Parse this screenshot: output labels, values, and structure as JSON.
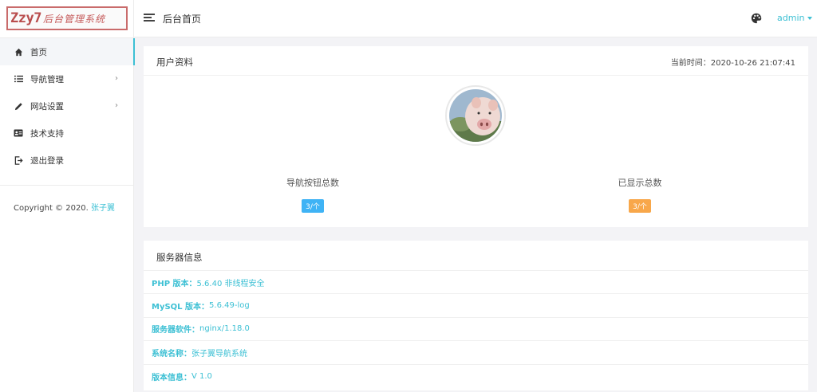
{
  "logo": {
    "main": "Zzy7",
    "sub": "后台管理系统"
  },
  "header": {
    "title": "后台首页",
    "user": "admin",
    "theme_icon": "palette-icon",
    "menu_icon": "menu-toggle-icon"
  },
  "sidebar": {
    "items": [
      {
        "label": "首页",
        "icon": "home-icon",
        "active": true,
        "has_children": false
      },
      {
        "label": "导航管理",
        "icon": "list-icon",
        "active": false,
        "has_children": true
      },
      {
        "label": "网站设置",
        "icon": "pencil-icon",
        "active": false,
        "has_children": true
      },
      {
        "label": "技术支持",
        "icon": "id-card-icon",
        "active": false,
        "has_children": false
      },
      {
        "label": "退出登录",
        "icon": "logout-icon",
        "active": false,
        "has_children": false
      }
    ],
    "copyright_prefix": "Copyright © 2020.",
    "copyright_author": "张子翼"
  },
  "profile": {
    "title": "用户资料",
    "time_label": "当前时间：",
    "time_value": "2020-10-26 21:07:41",
    "stats": [
      {
        "label": "导航按钮总数",
        "value": "3/个",
        "color": "#3fb3f5"
      },
      {
        "label": "已显示总数",
        "value": "3/个",
        "color": "#f8a74a"
      }
    ]
  },
  "server": {
    "title": "服务器信息",
    "rows": [
      {
        "label": "PHP 版本：",
        "value": "5.6.40 非线程安全"
      },
      {
        "label": "MySQL 版本：",
        "value": "5.6.49-log"
      },
      {
        "label": "服务器软件：",
        "value": "nginx/1.18.0"
      },
      {
        "label": "系统名称：",
        "value": "张子翼导航系统"
      },
      {
        "label": "版本信息：",
        "value": "V 1.0"
      }
    ]
  },
  "colors": {
    "accent": "#3dc0d4",
    "badge_blue": "#3fb3f5",
    "badge_orange": "#f8a74a",
    "logo_red": "#b94d4d"
  }
}
